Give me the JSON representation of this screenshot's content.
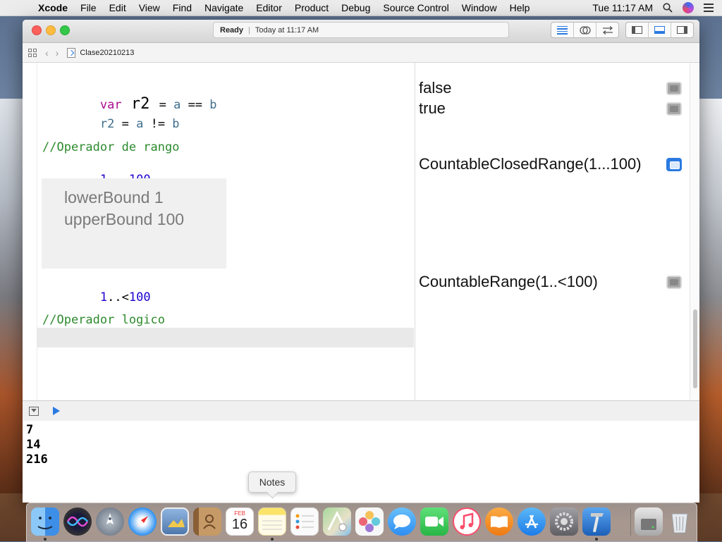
{
  "menubar": {
    "apple": "",
    "app_name": "Xcode",
    "items": [
      "File",
      "Edit",
      "View",
      "Find",
      "Navigate",
      "Editor",
      "Product",
      "Debug",
      "Source Control",
      "Window",
      "Help"
    ],
    "clock": "Tue 11:17 AM"
  },
  "window": {
    "status": "Ready",
    "status_separator": "|",
    "status_time": "Today at 11:17 AM",
    "breadcrumb_file": "Clase20210213"
  },
  "code": {
    "line1": {
      "kw": "var",
      "name": " r2 ",
      "op1": "= ",
      "a": "a",
      "op2": " == ",
      "b": "b"
    },
    "line2": {
      "name": "r2",
      "op1": " = ",
      "a": "a",
      "op2": " != ",
      "b": "b"
    },
    "line3": "//Operador de rango",
    "line4": {
      "start": "1",
      "op": "...",
      "end": "100"
    },
    "inline_result": [
      "lowerBound 1",
      "upperBound 100"
    ],
    "line5": {
      "start": "1",
      "op": "..<",
      "end": "100"
    },
    "line6": "//Operador logico"
  },
  "results": {
    "r1": "false",
    "r2": "true",
    "r3": "CountableClosedRange(1...100)",
    "r4": "CountableRange(1..<100)"
  },
  "console": {
    "lines": [
      "7",
      "14",
      "216"
    ]
  },
  "tooltip": "Notes",
  "dock": {
    "apps": [
      {
        "name": "Finder",
        "color": "#3d8ee6"
      },
      {
        "name": "Siri",
        "color": "#3b3b8a"
      },
      {
        "name": "Launchpad",
        "color": "#6c7b8c"
      },
      {
        "name": "Safari",
        "color": "#2b8ff0"
      },
      {
        "name": "Preview",
        "color": "#6a90c2"
      },
      {
        "name": "Contacts",
        "color": "#b88a55"
      },
      {
        "name": "Calendar",
        "color": "#ffffff"
      },
      {
        "name": "Notes",
        "color": "#fbe46a"
      },
      {
        "name": "Reminders",
        "color": "#fafafa"
      },
      {
        "name": "Maps",
        "color": "#7fc47a"
      },
      {
        "name": "Photos",
        "color": "#f3f3f3"
      },
      {
        "name": "Messages",
        "color": "#3ea4f7"
      },
      {
        "name": "FaceTime",
        "color": "#3fcf5a"
      },
      {
        "name": "Music",
        "color": "#fb4d6b"
      },
      {
        "name": "Books",
        "color": "#f38a1f"
      },
      {
        "name": "App Store",
        "color": "#2d8ef1"
      },
      {
        "name": "System Preferences",
        "color": "#8e8e93"
      },
      {
        "name": "Xcode",
        "color": "#2c79d6"
      },
      {
        "name": "Disk Utility",
        "color": "#bcbcbc"
      },
      {
        "name": "Trash",
        "color": "#dfe3e8"
      }
    ],
    "calendar_month": "FEB",
    "calendar_day": "16"
  }
}
